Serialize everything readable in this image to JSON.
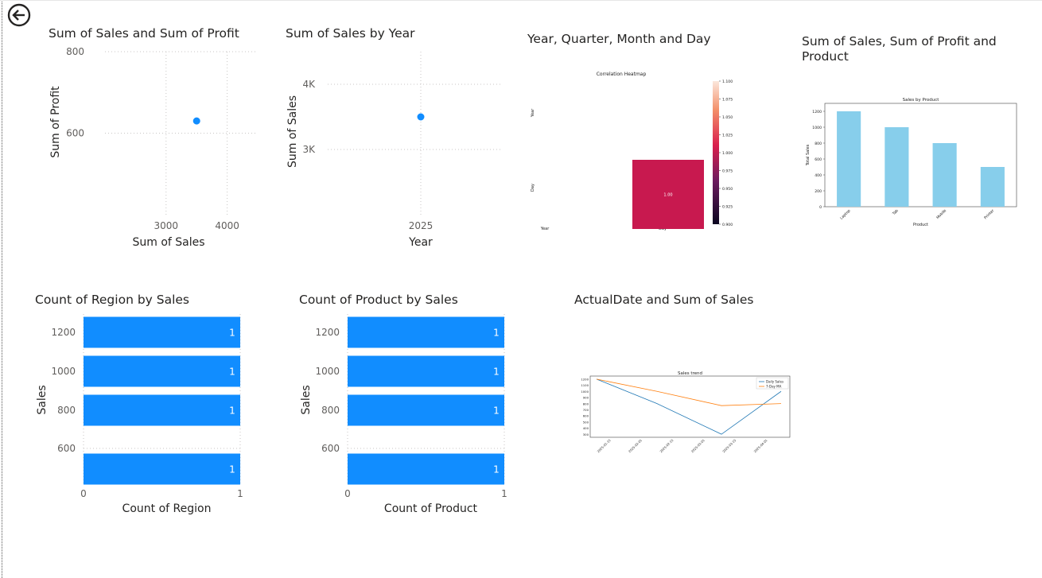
{
  "colors": {
    "accent": "#118DFF",
    "text": "#252423",
    "muted": "#605E5C",
    "grid": "#C8C6C4",
    "light_blue": "#87CEEB",
    "heat_cell": "#C8194F",
    "daily": "#1F77B4",
    "ma": "#FF7F0E"
  },
  "nav": {
    "back_icon": "back-arrow-icon"
  },
  "visuals": {
    "v1": {
      "title": "Sum of Sales and Sum of Profit"
    },
    "v2": {
      "title": "Sum of Sales by Year"
    },
    "v3": {
      "title": "Year, Quarter, Month and Day"
    },
    "v4": {
      "title_line1": "Sum of Sales, Sum of Profit and",
      "title_line2": "Product"
    },
    "v5": {
      "title": "Count of Region by Sales"
    },
    "v6": {
      "title": "Count of Product by Sales"
    },
    "v7": {
      "title": "ActualDate and Sum of Sales"
    }
  },
  "chart_data": [
    {
      "id": "v1",
      "type": "scatter",
      "title": "Sum of Sales and Sum of Profit",
      "xlabel": "Sum of Sales",
      "ylabel": "Sum of Profit",
      "xlim": [
        2000,
        4500
      ],
      "ylim": [
        400,
        800
      ],
      "xticks": [
        3000,
        4000
      ],
      "xtick_labels": [
        "3000",
        "4000"
      ],
      "yticks": [
        600,
        800
      ],
      "ytick_labels": [
        "600",
        "800"
      ],
      "points": [
        {
          "x": 3500,
          "y": 630
        }
      ],
      "grid": true
    },
    {
      "id": "v2",
      "type": "scatter",
      "title": "Sum of Sales by Year",
      "xlabel": "Year",
      "ylabel": "Sum of Sales",
      "ylim": [
        2000,
        4500
      ],
      "yticks": [
        3000,
        4000
      ],
      "ytick_labels": [
        "3K",
        "4K"
      ],
      "categories": [
        "2025"
      ],
      "points": [
        {
          "x": "2025",
          "y": 3500
        }
      ],
      "grid": true
    },
    {
      "id": "v3",
      "type": "heatmap",
      "title": "Correlation Heatmap",
      "rows": [
        "Year",
        "Day"
      ],
      "cols": [
        "Year",
        "Day"
      ],
      "cells": [
        {
          "row": "Day",
          "col": "Day",
          "value": 1.0,
          "label": "1.00"
        }
      ],
      "colorbar_ticks": [
        1.1,
        1.075,
        1.05,
        1.025,
        1.0,
        0.975,
        0.95,
        0.925,
        0.9
      ],
      "colorbar_labels": [
        "1.100",
        "1.075",
        "1.050",
        "1.025",
        "1.000",
        "0.975",
        "0.950",
        "0.925",
        "0.900"
      ]
    },
    {
      "id": "v4",
      "type": "bar",
      "title": "Sales by Product",
      "xlabel": "Product",
      "ylabel": "Total Sales",
      "categories": [
        "Laptop",
        "Tab",
        "Mobile",
        "Printer"
      ],
      "values": [
        1200,
        1000,
        800,
        500
      ],
      "ylim": [
        0,
        1300
      ],
      "yticks": [
        0,
        200,
        400,
        600,
        800,
        1000,
        1200
      ]
    },
    {
      "id": "v5",
      "type": "bar",
      "orientation": "horizontal",
      "title": "Count of Region by Sales",
      "xlabel": "Count of Region",
      "ylabel": "Sales",
      "categories": [
        1200,
        1000,
        800,
        500
      ],
      "values": [
        1,
        1,
        1,
        1
      ],
      "ytick_labels": [
        "1200",
        "1000",
        "800",
        "600"
      ],
      "yticks": [
        1200,
        1000,
        800,
        600
      ],
      "xlim": [
        0,
        1
      ],
      "xtick_labels": [
        "0",
        "1"
      ],
      "data_labels": [
        "1",
        "1",
        "1",
        "1"
      ]
    },
    {
      "id": "v6",
      "type": "bar",
      "orientation": "horizontal",
      "title": "Count of Product by Sales",
      "xlabel": "Count of Product",
      "ylabel": "Sales",
      "categories": [
        1200,
        1000,
        800,
        500
      ],
      "values": [
        1,
        1,
        1,
        1
      ],
      "ytick_labels": [
        "1200",
        "1000",
        "800",
        "600"
      ],
      "yticks": [
        1200,
        1000,
        800,
        600
      ],
      "xlim": [
        0,
        1
      ],
      "xtick_labels": [
        "0",
        "1"
      ],
      "data_labels": [
        "1",
        "1",
        "1",
        "1"
      ]
    },
    {
      "id": "v7",
      "type": "line",
      "title": "Sales trend",
      "x": [
        "2025-01-01",
        "2025-02-01",
        "2025-03-01",
        "2025-04-01"
      ],
      "xtick_labels": [
        "2025-01-15",
        "2025-02-01",
        "2025-02-15",
        "2025-03-01",
        "2025-03-15",
        "2025-04-01"
      ],
      "yticks": [
        300,
        400,
        500,
        600,
        700,
        800,
        900,
        1000,
        1100,
        1200
      ],
      "ylim": [
        250,
        1250
      ],
      "series": [
        {
          "name": "Daily Sales",
          "values": [
            1200,
            800,
            300,
            1000
          ]
        },
        {
          "name": "7-Day MA",
          "values": [
            1200,
            1000,
            767,
            800
          ]
        }
      ],
      "legend": "top-right"
    }
  ]
}
